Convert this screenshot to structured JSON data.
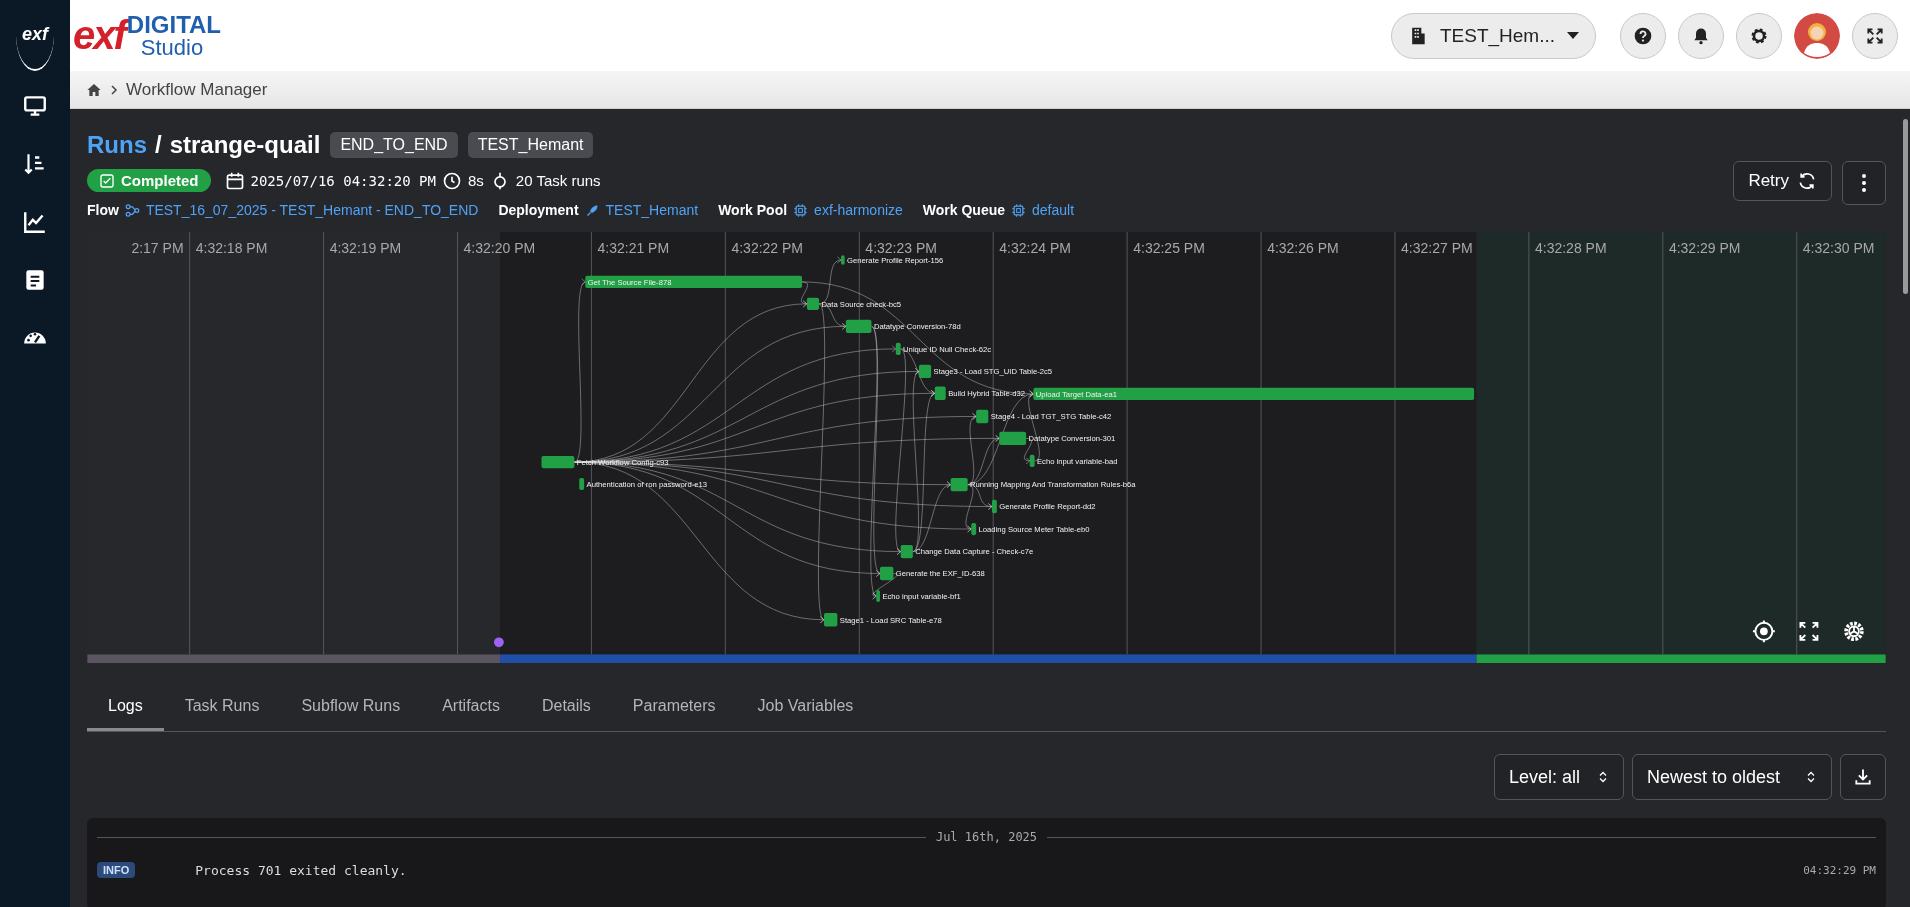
{
  "sidebar": {
    "logo": "exf"
  },
  "header": {
    "logo": {
      "brand": "exf",
      "word": "DIGITAL",
      "sub": "Studio"
    },
    "workspace": "TEST_Hem..."
  },
  "breadcrumb": [
    "Workflow Manager"
  ],
  "run": {
    "section": "Runs",
    "separator": "/",
    "name": "strange-quail",
    "tags": [
      "END_TO_END",
      "TEST_Hemant"
    ],
    "status": {
      "kind": "completed",
      "label": "Completed"
    },
    "started": "2025/07/16 04:32:20 PM",
    "duration": "8s",
    "task_runs": "20 Task runs",
    "meta": [
      {
        "kind": "flow",
        "label": "Flow",
        "value": "TEST_16_07_2025 - TEST_Hemant - END_TO_END"
      },
      {
        "kind": "deployment",
        "label": "Deployment",
        "value": "TEST_Hemant"
      },
      {
        "kind": "pool",
        "label": "Work Pool",
        "value": "exf-harmonize"
      },
      {
        "kind": "queue",
        "label": "Work Queue",
        "value": "default"
      }
    ],
    "retry": "Retry"
  },
  "timeline": {
    "ticks": [
      "2:17 PM",
      "4:32:18 PM",
      "4:32:19 PM",
      "4:32:20 PM",
      "4:32:21 PM",
      "4:32:22 PM",
      "4:32:23 PM",
      "4:32:24 PM",
      "4:32:25 PM",
      "4:32:26 PM",
      "4:32:27 PM",
      "4:32:28 PM",
      "4:32:29 PM",
      "4:32:30 PM"
    ],
    "tasks": [
      {
        "label": "Generate Profile Report-156"
      },
      {
        "label": "Get The Source File-878"
      },
      {
        "label": "Data Source check-bc5"
      },
      {
        "label": "Datatype Conversion-78d"
      },
      {
        "label": "Unique ID Null Check-62c"
      },
      {
        "label": "Stage3 - Load STG_UID Table-2c5"
      },
      {
        "label": "Build Hybrid Table-d32"
      },
      {
        "label": "Upload Target Data-ea1"
      },
      {
        "label": "Stage4 - Load TGT_STG Table-c42"
      },
      {
        "label": "Datatype Conversion-301"
      },
      {
        "label": "Fetch Workflow Config-c93"
      },
      {
        "label": "Echo input variable-bad"
      },
      {
        "label": "Authentication of ron password-e13"
      },
      {
        "label": "Running Mapping And Transformation Rules-b6a"
      },
      {
        "label": "Generate Profile Report-dd2"
      },
      {
        "label": "Loading Source Meter Table-eb0"
      },
      {
        "label": "Change Data Capture - Check-c7e"
      },
      {
        "label": "Generate the EXF_ID-638"
      },
      {
        "label": "Echo input variable-bf1"
      },
      {
        "label": "Stage1 - Load SRC Table-e78"
      }
    ]
  },
  "tabs": [
    {
      "label": "Logs",
      "selected": true
    },
    {
      "label": "Task Runs",
      "selected": false
    },
    {
      "label": "Subflow Runs",
      "selected": false
    },
    {
      "label": "Artifacts",
      "selected": false
    },
    {
      "label": "Details",
      "selected": false
    },
    {
      "label": "Parameters",
      "selected": false
    },
    {
      "label": "Job Variables",
      "selected": false
    }
  ],
  "logs": {
    "level": "Level: all",
    "sort": "Newest to oldest",
    "date": "Jul 16th, 2025",
    "entries": [
      {
        "level": "INFO",
        "message": "Process 701 exited cleanly.",
        "time": "04:32:29 PM"
      }
    ]
  }
}
